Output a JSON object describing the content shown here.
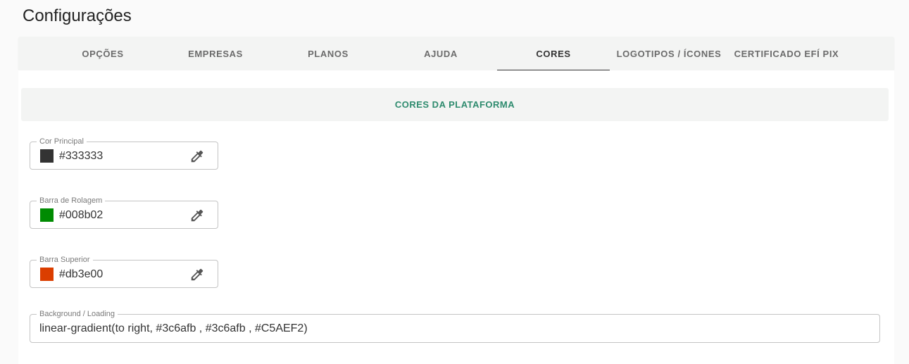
{
  "page": {
    "title": "Configurações"
  },
  "tabs": [
    {
      "label": "OPÇÕES"
    },
    {
      "label": "EMPRESAS"
    },
    {
      "label": "PLANOS"
    },
    {
      "label": "AJUDA"
    },
    {
      "label": "CORES",
      "active": true
    },
    {
      "label": "LOGOTIPOS / ÍCONES"
    },
    {
      "label": "CERTIFICADO EFÍ PIX"
    }
  ],
  "section": {
    "title": "CORES DA PLATAFORMA"
  },
  "colors": {
    "primary": {
      "label": "Cor Principal",
      "value": "#333333",
      "swatch": "#333333"
    },
    "scrollbar": {
      "label": "Barra de Rolagem",
      "value": "#008b02",
      "swatch": "#008b02"
    },
    "topbar": {
      "label": "Barra Superior",
      "value": "#db3e00",
      "swatch": "#db3e00"
    }
  },
  "background": {
    "label": "Background / Loading",
    "value": "linear-gradient(to right, #3c6afb , #3c6afb , #C5AEF2)"
  },
  "icons": {
    "picker": "eyedropper-icon"
  },
  "accent": "#2e8b6e"
}
